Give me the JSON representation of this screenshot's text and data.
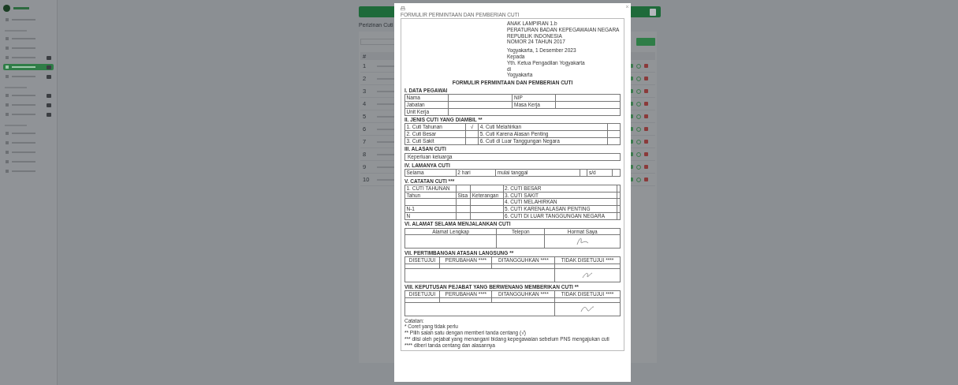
{
  "sidebar": {
    "items": [
      {
        "kind": "item",
        "selected": false,
        "badge": false
      },
      {
        "kind": "heading"
      },
      {
        "kind": "item",
        "selected": false,
        "badge": false
      },
      {
        "kind": "item",
        "selected": false,
        "badge": false
      },
      {
        "kind": "item",
        "selected": false,
        "badge": true
      },
      {
        "kind": "item",
        "selected": true,
        "badge": true
      },
      {
        "kind": "item",
        "selected": false,
        "badge": true
      },
      {
        "kind": "heading"
      },
      {
        "kind": "item",
        "selected": false,
        "badge": true
      },
      {
        "kind": "item",
        "selected": false,
        "badge": true
      },
      {
        "kind": "item",
        "selected": false,
        "badge": true
      },
      {
        "kind": "heading"
      },
      {
        "kind": "item",
        "selected": false,
        "badge": false
      },
      {
        "kind": "item",
        "selected": false,
        "badge": false
      },
      {
        "kind": "item",
        "selected": false,
        "badge": false
      },
      {
        "kind": "item",
        "selected": false,
        "badge": false
      },
      {
        "kind": "item",
        "selected": false,
        "badge": false
      }
    ]
  },
  "page": {
    "title": "Perizinan Cuti"
  },
  "table": {
    "columns": [
      "#"
    ],
    "rows": [
      {
        "number": "1"
      },
      {
        "number": "2"
      },
      {
        "number": "3"
      },
      {
        "number": "4"
      },
      {
        "number": "5"
      },
      {
        "number": "6"
      },
      {
        "number": "7"
      },
      {
        "number": "8"
      },
      {
        "number": "9"
      },
      {
        "number": "10"
      }
    ]
  },
  "modal": {
    "form_title_top": "FORMULIR PERMINTAAN DAN PEMBERIAN CUTI",
    "regulation_lines": [
      "ANAK LAMPIRAN 1.b",
      "PERATURAN BADAN KEPEGAWAIAN NEGARA",
      "REPUBLIK INDONESIA",
      "NOMOR 24 TAHUN 2017"
    ],
    "addressee_lines": [
      "Yogyakarta, 1 Desember 2023",
      "Kepada",
      "Yth. Ketua Pengadilan Yogyakarta",
      "di",
      "Yogyakarta"
    ],
    "form_title": "FORMULIR PERMINTAAN DAN PEMBERIAN CUTI",
    "section_1": {
      "title": "I. DATA PEGAWAI",
      "rows": [
        [
          "Nama",
          "",
          "NIP",
          ""
        ],
        [
          "Jabatan",
          "",
          "Masa Kerja",
          ""
        ],
        [
          "Unit Kerja",
          ""
        ]
      ]
    },
    "section_2": {
      "title": "II. JENIS CUTI YANG DIAMBIL **",
      "check_mark": "√",
      "options": [
        {
          "label": "1. Cuti Tahunan",
          "checked": true
        },
        {
          "label": "2. Cuti Besar",
          "checked": false
        },
        {
          "label": "3. Cuti Sakit",
          "checked": false
        },
        {
          "label": "4. Cuti Melahirkan",
          "checked": false
        },
        {
          "label": "5. Cuti Karena Alasan Penting",
          "checked": false
        },
        {
          "label": "6. Cuti di Luar Tanggungan Negara",
          "checked": false
        }
      ]
    },
    "section_3": {
      "title": "III. ALASAN CUTI",
      "reason": "Keperluan keluarga"
    },
    "section_4": {
      "title": "IV. LAMANYA CUTI",
      "cells": [
        "Selama",
        "2 hari",
        "mulai tanggal",
        "",
        "s/d",
        ""
      ]
    },
    "section_5": {
      "title": "V. CATATAN CUTI ***",
      "rows": [
        [
          "1. CUTI TAHUNAN",
          "",
          "",
          "2. CUTI BESAR",
          ""
        ],
        [
          "Tahun",
          "Sisa",
          "Keterangan",
          "3. CUTI SAKIT",
          ""
        ],
        [
          "",
          "",
          "",
          "4. CUTI MELAHIRKAN",
          ""
        ],
        [
          "N-1",
          "",
          "",
          "5. CUTI KARENA ALASAN PENTING",
          ""
        ],
        [
          "N",
          "",
          "",
          "6. CUTI DI LUAR TANGGUNGAN NEGARA",
          ""
        ]
      ]
    },
    "section_6": {
      "title": "VI. ALAMAT SELAMA MENJALANKAN CUTI",
      "columns": [
        "Alamat Lengkap",
        "Telepon",
        "Hormat Saya"
      ]
    },
    "section_7": {
      "title": "VII. PERTIMBANGAN ATASAN LANGSUNG **",
      "columns": [
        "DISETUJUI",
        "PERUBAHAN ****",
        "DITANGGUHKAN ****",
        "TIDAK DISETUJUI ****"
      ]
    },
    "section_8": {
      "title": "VIII. KEPUTUSAN PEJABAT YANG BERWENANG MEMBERIKAN CUTI **",
      "columns": [
        "DISETUJUI",
        "PERUBAHAN ****",
        "DITANGGUHKAN ****",
        "TIDAK DISETUJUI ****"
      ]
    },
    "notes": [
      "Catatan:",
      "* Coret yang tidak perlu",
      "** Pilih salah satu dengan memberi tanda centang (√)",
      "*** diisi oleh pejabat yang menangani bidang kepegawaian sebelum PNS mengajukan cuti",
      "**** diberi tanda centang dan alasannya"
    ]
  }
}
